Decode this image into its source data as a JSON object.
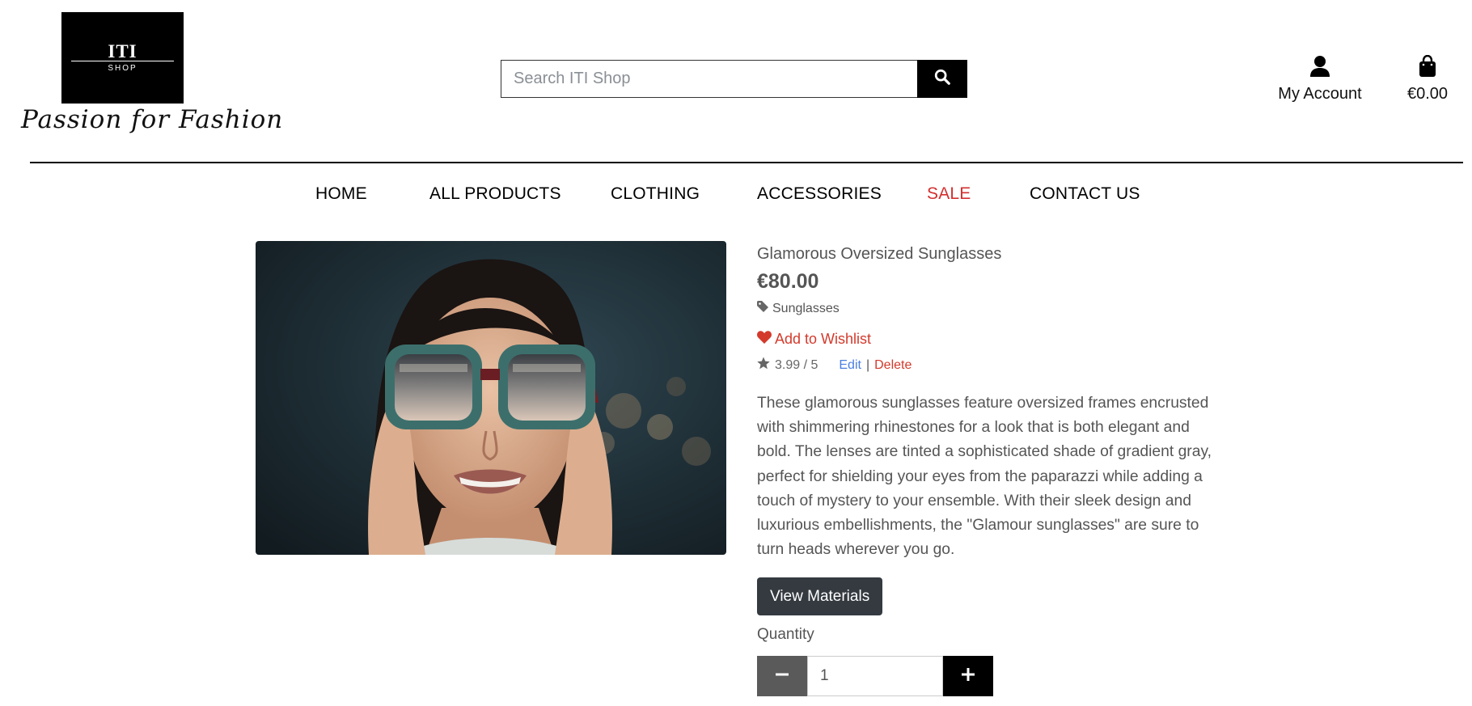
{
  "brand": {
    "logo_title": "ITI",
    "logo_subtitle": "SHOP",
    "tagline": "Passion for Fashion"
  },
  "search": {
    "placeholder": "Search ITI Shop",
    "value": "",
    "icon": "search-icon"
  },
  "header": {
    "account_label": "My Account",
    "account_icon": "user-icon",
    "cart_total": "€0.00",
    "cart_icon": "shopping-bag-icon"
  },
  "nav": {
    "items": [
      {
        "label": "Home"
      },
      {
        "label": "All Products"
      },
      {
        "label": "Clothing"
      },
      {
        "label": "Accessories"
      },
      {
        "label": "Sale",
        "color": "#d32f2f"
      },
      {
        "label": "Contact Us"
      }
    ]
  },
  "product": {
    "title": "Glamorous Oversized Sunglasses",
    "price": "€80.00",
    "category": "Sunglasses",
    "category_icon": "tag-icon",
    "wishlist_label": "Add to Wishlist",
    "wishlist_icon": "heart-icon",
    "rating": "3.99 / 5",
    "rating_icon": "star-icon",
    "edit_label": "Edit",
    "separator": "|",
    "delete_label": "Delete",
    "description": "These glamorous sunglasses feature oversized frames encrusted with shimmering rhinestones for a look that is both elegant and bold. The lenses are tinted a sophisticated shade of gradient gray, perfect for shielding your eyes from the paparazzi while adding a touch of mystery to your ensemble. With their sleek design and luxurious embellishments, the \"Glamour sunglasses\" are sure to turn heads wherever you go.",
    "materials_button": "View Materials",
    "quantity_label": "Quantity",
    "quantity_value": "1",
    "minus_icon": "minus-icon",
    "plus_icon": "plus-icon"
  },
  "colors": {
    "sale": "#d32f2f",
    "wishlist": "#d33a2c",
    "edit_link": "#4a7ee0",
    "dark_button": "#343a40"
  }
}
